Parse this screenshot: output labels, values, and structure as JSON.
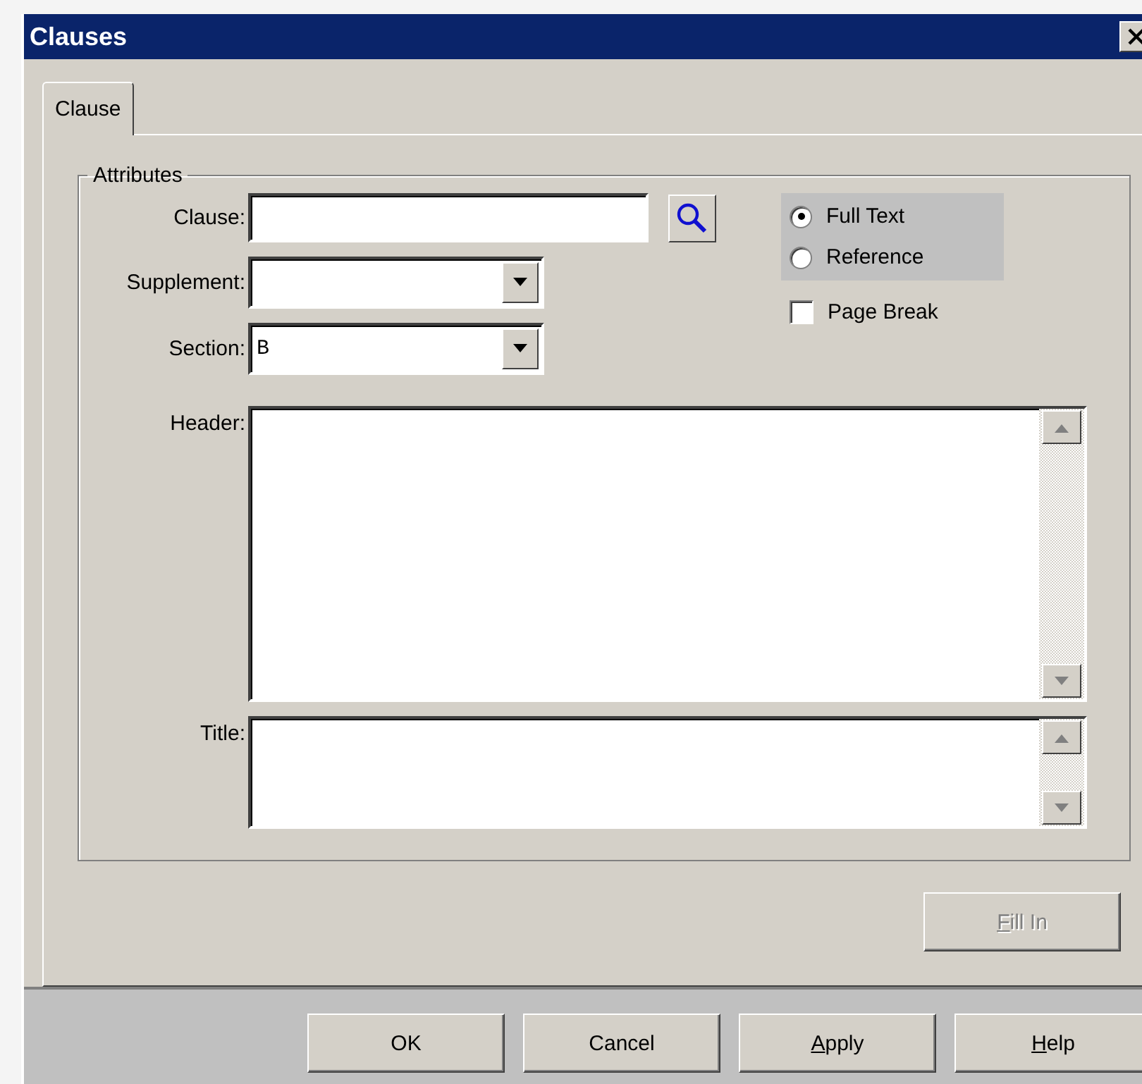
{
  "window": {
    "title": "Clauses"
  },
  "tabs": [
    {
      "label": "Clause",
      "selected": true
    }
  ],
  "group": {
    "title": "Attributes"
  },
  "fields": {
    "clause": {
      "label": "Clause:"
    },
    "supplement": {
      "label": "Supplement:"
    },
    "section": {
      "label": "Section:",
      "value": "B"
    },
    "header": {
      "label": "Header:"
    },
    "title": {
      "label": "Title:"
    }
  },
  "options": [
    {
      "label": "Full Text",
      "selected": true
    },
    {
      "label": "Reference",
      "selected": false
    }
  ],
  "page_break": {
    "label": "Page Break",
    "checked": false
  },
  "fill_in": {
    "label": "Fill In",
    "mnemonic": true,
    "disabled": true
  },
  "buttons": [
    {
      "label": "OK",
      "mnemonic": false
    },
    {
      "label": "Cancel",
      "mnemonic": false
    },
    {
      "label": "Apply",
      "mnemonic": true
    },
    {
      "label": "Help",
      "mnemonic": true
    }
  ]
}
